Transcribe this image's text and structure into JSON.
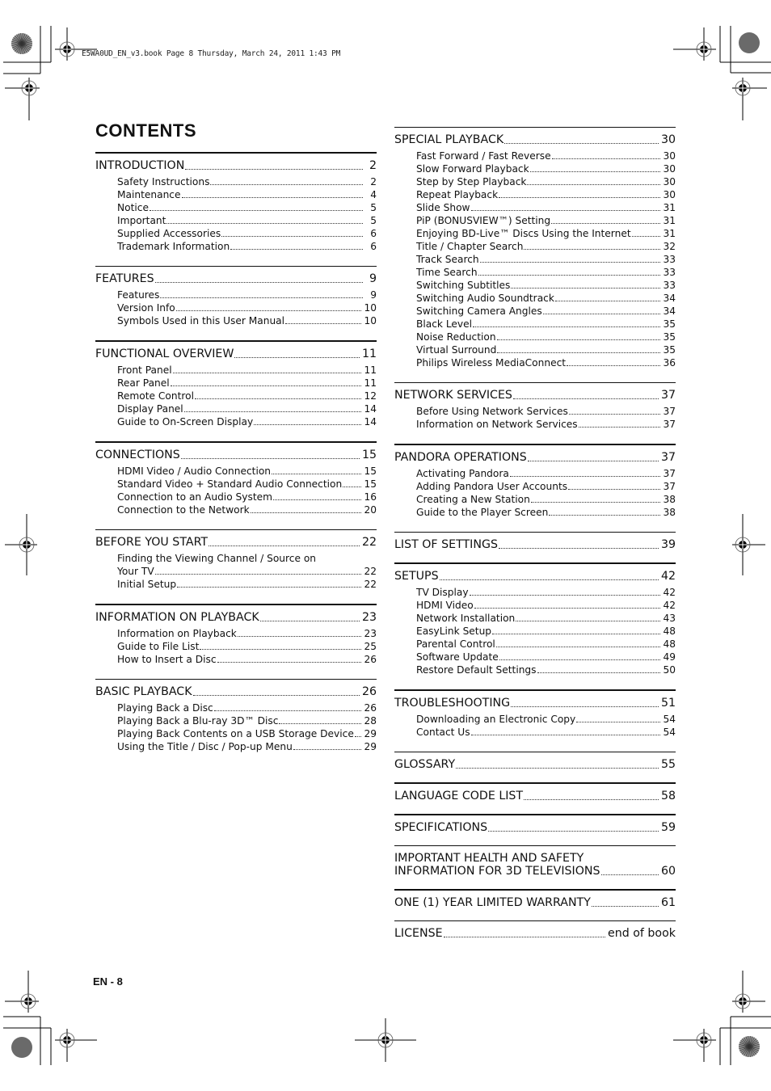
{
  "header_slug": "E5WA0UD_EN_v3.book  Page 8  Thursday, March 24, 2011  1:43 PM",
  "title": "CONTENTS",
  "page_label": "EN - 8",
  "left_column": [
    {
      "title": "INTRODUCTION",
      "page": "2",
      "rule": "thick",
      "items": [
        {
          "title": "Safety Instructions",
          "page": "2"
        },
        {
          "title": "Maintenance",
          "page": "4"
        },
        {
          "title": "Notice",
          "page": "5"
        },
        {
          "title": "Important",
          "page": "5"
        },
        {
          "title": "Supplied Accessories",
          "page": "6"
        },
        {
          "title": "Trademark Information",
          "page": "6"
        }
      ]
    },
    {
      "title": "FEATURES",
      "page": "9",
      "rule": "thin",
      "items": [
        {
          "title": "Features",
          "page": "9"
        },
        {
          "title": "Version Info",
          "page": "10"
        },
        {
          "title": "Symbols Used in this User Manual",
          "page": "10"
        }
      ]
    },
    {
      "title": "FUNCTIONAL OVERVIEW",
      "page": "11",
      "rule": "thick",
      "items": [
        {
          "title": "Front Panel",
          "page": "11"
        },
        {
          "title": "Rear Panel",
          "page": "11"
        },
        {
          "title": "Remote Control",
          "page": "12"
        },
        {
          "title": "Display Panel",
          "page": "14"
        },
        {
          "title": "Guide to On-Screen Display",
          "page": "14"
        }
      ]
    },
    {
      "title": "CONNECTIONS",
      "page": "15",
      "rule": "thick",
      "items": [
        {
          "title": "HDMI Video / Audio Connection",
          "page": "15"
        },
        {
          "title": "Standard Video + Standard Audio Connection",
          "page": "15"
        },
        {
          "title": "Connection to an Audio System",
          "page": "16"
        },
        {
          "title": "Connection to the Network",
          "page": "20"
        }
      ]
    },
    {
      "title": "BEFORE YOU START",
      "page": "22",
      "rule": "thin",
      "items": [
        {
          "title": "Finding the Viewing Channel / Source on",
          "cont": "Your TV",
          "page": "22"
        },
        {
          "title": "Initial Setup",
          "page": "22"
        }
      ]
    },
    {
      "title": "INFORMATION ON PLAYBACK",
      "page": "23",
      "rule": "thick",
      "items": [
        {
          "title": "Information on Playback",
          "page": "23"
        },
        {
          "title": "Guide to File List",
          "page": "25"
        },
        {
          "title": "How to Insert a Disc",
          "page": "26"
        }
      ]
    },
    {
      "title": "BASIC PLAYBACK",
      "page": "26",
      "rule": "thin",
      "items": [
        {
          "title": "Playing Back a Disc",
          "page": "26"
        },
        {
          "title": "Playing Back a Blu-ray 3D™ Disc",
          "page": "28"
        },
        {
          "title": "Playing Back Contents on a USB Storage Device",
          "page": "29"
        },
        {
          "title": "Using the Title / Disc / Pop-up Menu",
          "page": "29"
        }
      ]
    }
  ],
  "right_column": [
    {
      "title": "SPECIAL PLAYBACK",
      "page": "30",
      "rule": "thin",
      "items": [
        {
          "title": "Fast Forward / Fast Reverse",
          "page": "30"
        },
        {
          "title": "Slow Forward Playback",
          "page": "30"
        },
        {
          "title": "Step by Step Playback",
          "page": "30"
        },
        {
          "title": "Repeat Playback",
          "page": "30"
        },
        {
          "title": "Slide Show",
          "page": "31"
        },
        {
          "title": "PiP (BONUSVIEW™) Setting",
          "page": "31"
        },
        {
          "title": "Enjoying BD-Live™ Discs Using the Internet",
          "page": "31"
        },
        {
          "title": "Title / Chapter Search",
          "page": "32"
        },
        {
          "title": "Track Search",
          "page": "33"
        },
        {
          "title": "Time Search",
          "page": "33"
        },
        {
          "title": "Switching Subtitles",
          "page": "33"
        },
        {
          "title": "Switching Audio Soundtrack",
          "page": "34"
        },
        {
          "title": "Switching Camera Angles",
          "page": "34"
        },
        {
          "title": "Black Level",
          "page": "35"
        },
        {
          "title": "Noise Reduction",
          "page": "35"
        },
        {
          "title": "Virtual Surround",
          "page": "35"
        },
        {
          "title": "Philips Wireless MediaConnect",
          "page": "36"
        }
      ]
    },
    {
      "title": "NETWORK SERVICES",
      "page": "37",
      "rule": "thin",
      "items": [
        {
          "title": "Before Using Network Services",
          "page": "37"
        },
        {
          "title": "Information on Network Services",
          "page": "37"
        }
      ]
    },
    {
      "title": "PANDORA OPERATIONS",
      "page": "37",
      "rule": "thick",
      "items": [
        {
          "title": "Activating Pandora",
          "page": "37"
        },
        {
          "title": "Adding Pandora User Accounts",
          "page": "37"
        },
        {
          "title": "Creating a New Station",
          "page": "38"
        },
        {
          "title": "Guide to the Player Screen",
          "page": "38"
        }
      ]
    },
    {
      "title": "LIST OF SETTINGS",
      "page": "39",
      "rule": "thin",
      "items": []
    },
    {
      "title": "SETUPS",
      "page": "42",
      "rule": "thick",
      "items": [
        {
          "title": "TV Display",
          "page": "42"
        },
        {
          "title": "HDMI Video",
          "page": "42"
        },
        {
          "title": "Network Installation",
          "page": "43"
        },
        {
          "title": "EasyLink Setup",
          "page": "48"
        },
        {
          "title": "Parental Control",
          "page": "48"
        },
        {
          "title": "Software Update",
          "page": "49"
        },
        {
          "title": "Restore Default Settings",
          "page": "50"
        }
      ]
    },
    {
      "title": "TROUBLESHOOTING",
      "page": "51",
      "rule": "thick",
      "items": [
        {
          "title": "Downloading an Electronic Copy",
          "page": "54"
        },
        {
          "title": "Contact Us",
          "page": "54"
        }
      ]
    },
    {
      "title": "GLOSSARY",
      "page": "55",
      "rule": "thin",
      "items": []
    },
    {
      "title": "LANGUAGE CODE LIST",
      "page": "58",
      "rule": "thick",
      "items": []
    },
    {
      "title": "SPECIFICATIONS",
      "page": "59",
      "rule": "thick",
      "items": []
    },
    {
      "title": "IMPORTANT HEALTH AND SAFETY",
      "cont": "INFORMATION FOR 3D TELEVISIONS",
      "page": "60",
      "rule": "thin",
      "items": []
    },
    {
      "title": "ONE (1) YEAR LIMITED WARRANTY",
      "page": "61",
      "rule": "thick",
      "items": []
    },
    {
      "title": "LICENSE",
      "page": "end of book",
      "rule": "thin",
      "items": []
    }
  ],
  "icons": {
    "registration_mark": "crosshair-registration-icon",
    "color_bar": "print-target-circle-icon",
    "crop_mark": "crop-mark-icon"
  }
}
